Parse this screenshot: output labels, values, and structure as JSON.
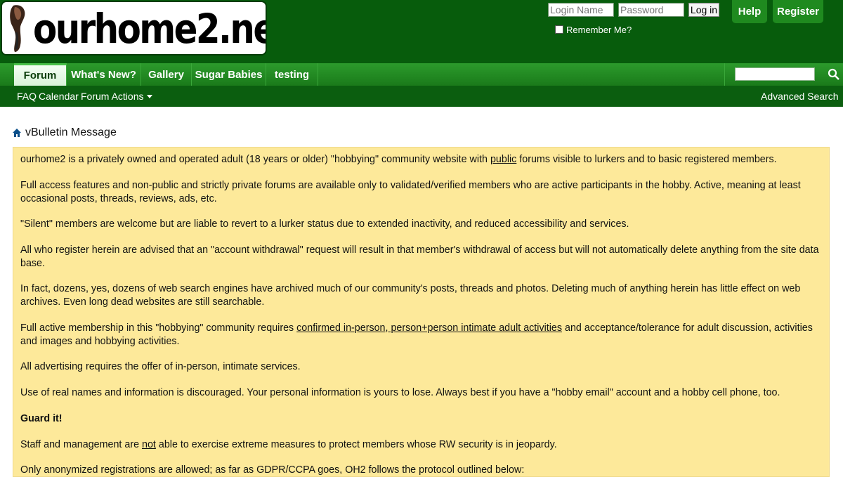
{
  "site": {
    "logo_text": "ourhome2.net"
  },
  "login": {
    "name_placeholder": "Login Name",
    "password_placeholder": "Password",
    "login_label": "Log in",
    "remember_label": "Remember Me?"
  },
  "top_links": {
    "help": "Help",
    "register": "Register"
  },
  "nav": {
    "tabs": [
      "Forum",
      "What's New?",
      "Gallery",
      "Sugar Babies",
      "testing"
    ],
    "active": "Forum"
  },
  "subnav": {
    "faq": "FAQ",
    "calendar": "Calendar",
    "forum_actions": "Forum Actions",
    "advanced_search": "Advanced Search"
  },
  "breadcrumb": {
    "title": "vBulletin Message"
  },
  "message": {
    "p1_before": "ourhome2 is a privately owned and operated adult (18 years or older) \"hobbying\" community website with ",
    "p1_link": "public",
    "p1_after": " forums visible to lurkers and to basic registered members.",
    "p2": "Full access features and non-public and strictly private forums are available only to validated/verified members who are active participants in the hobby. Active, meaning at least occasional posts, threads, reviews, ads, etc.",
    "p3": "\"Silent\" members are welcome but are liable to revert to a lurker status due to extended inactivity, and reduced accessibility and services.",
    "p4": "All who register herein are advised that an \"account withdrawal\" request will result in that member's withdrawal of access but will not automatically delete anything from the site data base.",
    "p5": "In fact, dozens, yes, dozens of web search engines have archived much of our community's posts, threads and photos. Deleting much of anything herein has little effect on web archives. Even long dead websites are still searchable.",
    "p6_before": "Full active membership in this \"hobbying\" community requires ",
    "p6_link": "confirmed in-person, person+person intimate adult activities",
    "p6_after": " and acceptance/tolerance for adult discussion, activities and images and hobbying activities.",
    "p7": "All advertising requires the offer of in-person, intimate services.",
    "p8": "Use of real names and information is discouraged. Your personal information is yours to lose. Always best if you have a \"hobby email\" account and a hobby cell phone, too.",
    "p9": "Guard it!",
    "p10_before": "Staff and management are ",
    "p10_link": "not",
    "p10_after": " able to exercise extreme measures to protect members whose RW security is in jeopardy.",
    "p11": "Only anonymized registrations are allowed; as far as GDPR/CCPA goes, OH2 follows the protocol outlined below:"
  },
  "colors": {
    "header_bg": "#075c0c",
    "nav_green": "#1a7a1a",
    "message_bg": "#fde99a"
  }
}
